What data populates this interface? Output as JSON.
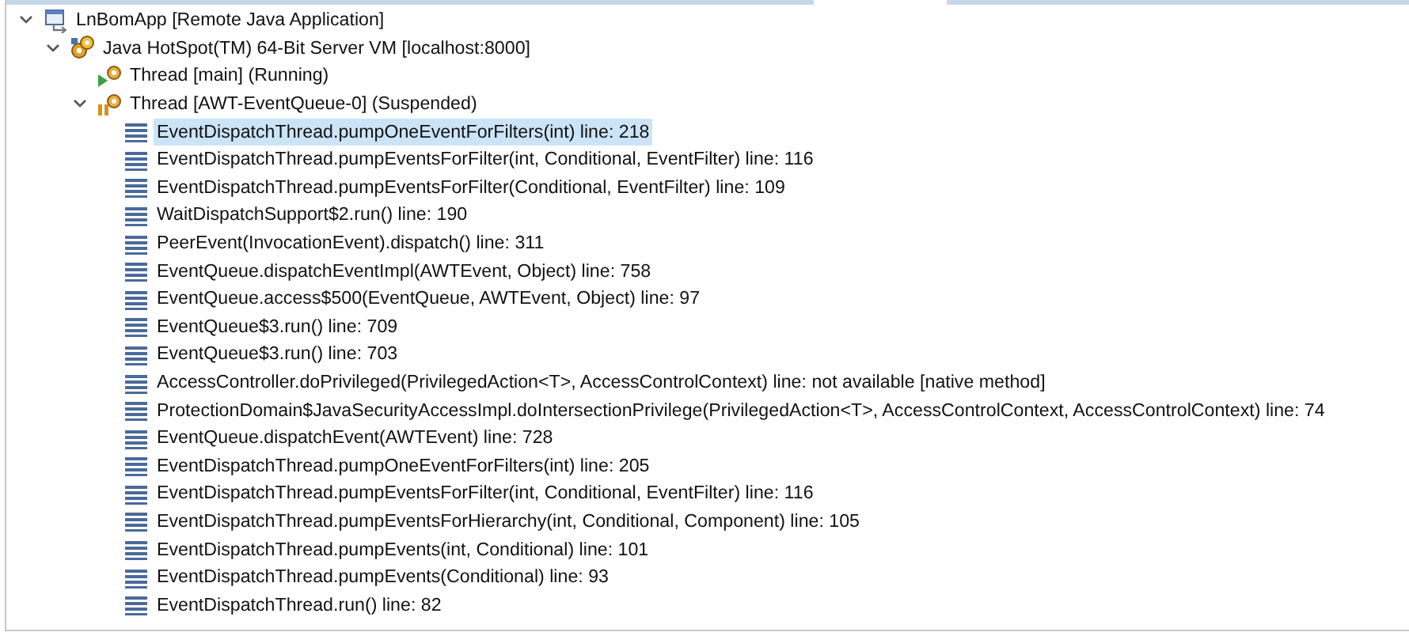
{
  "tree": [
    {
      "kind": "app",
      "label": "LnBomApp [Remote Java Application]",
      "expanded": true,
      "selected": false,
      "children": [
        {
          "kind": "vm",
          "label": "Java HotSpot(TM) 64-Bit Server VM [localhost:8000]",
          "expanded": true,
          "selected": false,
          "children": [
            {
              "kind": "thread-running",
              "label": "Thread [main] (Running)",
              "selected": false
            },
            {
              "kind": "thread-suspended",
              "label": "Thread [AWT-EventQueue-0] (Suspended)",
              "expanded": true,
              "selected": false,
              "children": [
                {
                  "kind": "frame",
                  "label": "EventDispatchThread.pumpOneEventForFilters(int) line: 218",
                  "selected": true
                },
                {
                  "kind": "frame",
                  "label": "EventDispatchThread.pumpEventsForFilter(int, Conditional, EventFilter) line: 116",
                  "selected": false
                },
                {
                  "kind": "frame",
                  "label": "EventDispatchThread.pumpEventsForFilter(Conditional, EventFilter) line: 109",
                  "selected": false
                },
                {
                  "kind": "frame",
                  "label": "WaitDispatchSupport$2.run() line: 190",
                  "selected": false
                },
                {
                  "kind": "frame",
                  "label": "PeerEvent(InvocationEvent).dispatch() line: 311",
                  "selected": false
                },
                {
                  "kind": "frame",
                  "label": "EventQueue.dispatchEventImpl(AWTEvent, Object) line: 758",
                  "selected": false
                },
                {
                  "kind": "frame",
                  "label": "EventQueue.access$500(EventQueue, AWTEvent, Object) line: 97",
                  "selected": false
                },
                {
                  "kind": "frame",
                  "label": "EventQueue$3.run() line: 709",
                  "selected": false
                },
                {
                  "kind": "frame",
                  "label": "EventQueue$3.run() line: 703",
                  "selected": false
                },
                {
                  "kind": "frame",
                  "label": "AccessController.doPrivileged(PrivilegedAction<T>, AccessControlContext) line: not available [native method]",
                  "selected": false
                },
                {
                  "kind": "frame",
                  "label": "ProtectionDomain$JavaSecurityAccessImpl.doIntersectionPrivilege(PrivilegedAction<T>, AccessControlContext, AccessControlContext) line: 74",
                  "selected": false
                },
                {
                  "kind": "frame",
                  "label": "EventQueue.dispatchEvent(AWTEvent) line: 728",
                  "selected": false
                },
                {
                  "kind": "frame",
                  "label": "EventDispatchThread.pumpOneEventForFilters(int) line: 205",
                  "selected": false
                },
                {
                  "kind": "frame",
                  "label": "EventDispatchThread.pumpEventsForFilter(int, Conditional, EventFilter) line: 116",
                  "selected": false
                },
                {
                  "kind": "frame",
                  "label": "EventDispatchThread.pumpEventsForHierarchy(int, Conditional, Component) line: 105",
                  "selected": false
                },
                {
                  "kind": "frame",
                  "label": "EventDispatchThread.pumpEvents(int, Conditional) line: 101",
                  "selected": false
                },
                {
                  "kind": "frame",
                  "label": "EventDispatchThread.pumpEvents(Conditional) line: 93",
                  "selected": false
                },
                {
                  "kind": "frame",
                  "label": "EventDispatchThread.run() line: 82",
                  "selected": false
                }
              ]
            }
          ]
        }
      ]
    }
  ]
}
